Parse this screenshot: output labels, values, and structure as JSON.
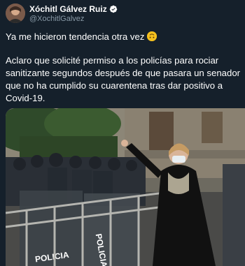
{
  "tweet": {
    "display_name": "Xóchitl Gálvez Ruiz",
    "handle": "@XochitlGalvez",
    "verified_icon": "verified-badge-icon",
    "line1": "Ya me hicieron tendencia otra vez",
    "emoji": "upside-down-face-emoji",
    "body": "Aclaro que solicité permiso a los policías para rociar sanitizante segundos después de que pasara un senador que no ha cumplido su cuarentena tras dar positivo a Covid-19."
  },
  "photo": {
    "barrier_text_1": "POLICIA",
    "barrier_text_2": "POLICIA"
  },
  "colors": {
    "background": "#15202b",
    "text": "#ffffff",
    "secondary_text": "#8899a6",
    "verified": "#1da1f2"
  }
}
